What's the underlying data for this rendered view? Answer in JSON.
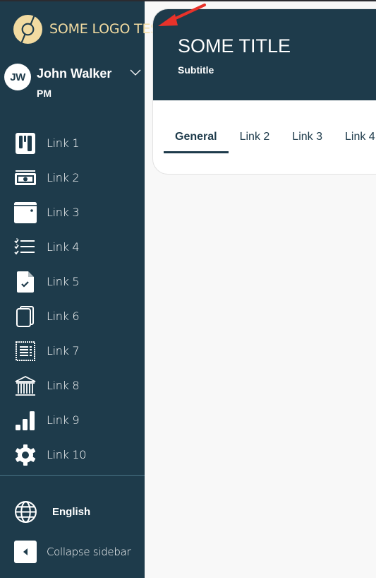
{
  "sidebar": {
    "logo_text": "SOME LOGO TEST",
    "user": {
      "initials": "JW",
      "name": "John Walker",
      "role": "PM"
    },
    "items": [
      {
        "label": "Link 1",
        "icon": "kanban-board-icon"
      },
      {
        "label": "Link 2",
        "icon": "money-bill-icon"
      },
      {
        "label": "Link 3",
        "icon": "wallet-icon"
      },
      {
        "label": "Link 4",
        "icon": "checklist-icon"
      },
      {
        "label": "Link 5",
        "icon": "document-check-icon"
      },
      {
        "label": "Link 6",
        "icon": "copy-documents-icon"
      },
      {
        "label": "Link 7",
        "icon": "receipt-icon"
      },
      {
        "label": "Link 8",
        "icon": "bank-icon"
      },
      {
        "label": "Link 9",
        "icon": "bar-chart-icon"
      },
      {
        "label": "Link 10",
        "icon": "gear-icon"
      }
    ],
    "language": "English",
    "collapse_label": "Collapse sidebar"
  },
  "main": {
    "title": "SOME TITLE",
    "subtitle": "Subtitle",
    "tabs": [
      {
        "label": "General",
        "active": true
      },
      {
        "label": "Link 2",
        "active": false
      },
      {
        "label": "Link 3",
        "active": false
      },
      {
        "label": "Link 4",
        "active": false
      }
    ]
  },
  "colors": {
    "sidebar_bg": "#1e3b4b",
    "logo_accent": "#f2dba1",
    "annotation": "#e8322a",
    "content_bg": "#f8f8f8"
  }
}
